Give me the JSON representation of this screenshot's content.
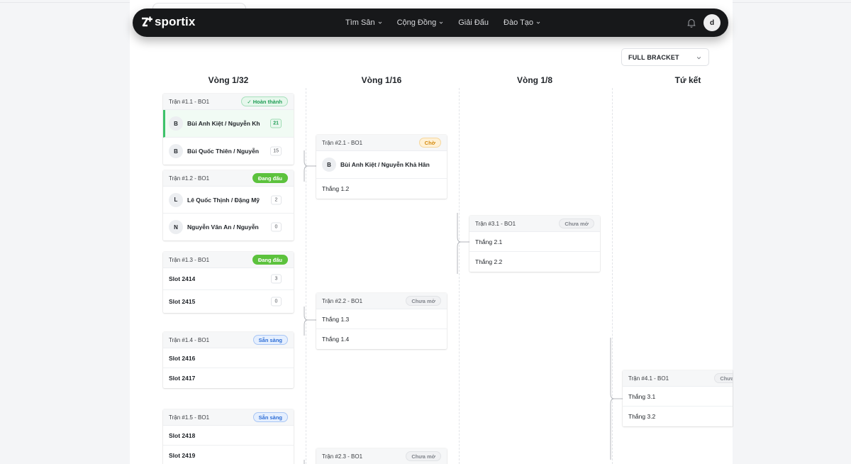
{
  "brand": {
    "name": "sportix"
  },
  "nav": {
    "items": [
      {
        "label": "Tìm Sân",
        "has_dropdown": true
      },
      {
        "label": "Cộng Đồng",
        "has_dropdown": true
      },
      {
        "label": "Giải Đấu",
        "has_dropdown": false
      },
      {
        "label": "Đào Tạo",
        "has_dropdown": true
      }
    ],
    "user_initial": "d"
  },
  "view_select": {
    "value": "FULL BRACKET"
  },
  "rounds": [
    "Vòng 1/32",
    "Vòng 1/16",
    "Vòng 1/8",
    "Tứ kết"
  ],
  "status_colors": {
    "done": "#1f9d55",
    "live": "#5cc23d",
    "ready": "#2f6fd6",
    "waiting": "#d48a0e",
    "closed": "#80848b"
  },
  "matches": {
    "m11": {
      "code": "Trận #1.1 - BO1",
      "status": "✓ Hoàn thành",
      "slots": [
        {
          "initial": "B",
          "name": "Bùi Anh Kiệt / Nguyễn Kh",
          "score": "21",
          "winner": true
        },
        {
          "initial": "B",
          "name": "Bùi Quốc Thiên / Nguyễn",
          "score": "15"
        }
      ]
    },
    "m12": {
      "code": "Trận #1.2 - BO1",
      "status": "Đang đấu",
      "slots": [
        {
          "initial": "L",
          "name": "Lê Quốc Thịnh / Đặng Mỹ",
          "score": "2"
        },
        {
          "initial": "N",
          "name": "Nguyễn Văn An / Nguyễn",
          "score": "0"
        }
      ]
    },
    "m13": {
      "code": "Trận #1.3 - BO1",
      "status": "Đang đấu",
      "slots": [
        {
          "name": "Slot 2414",
          "score": "3"
        },
        {
          "name": "Slot 2415",
          "score": "0"
        }
      ]
    },
    "m14": {
      "code": "Trận #1.4 - BO1",
      "status": "Sẵn sàng",
      "slots": [
        {
          "name": "Slot 2416"
        },
        {
          "name": "Slot 2417"
        }
      ]
    },
    "m15": {
      "code": "Trận #1.5 - BO1",
      "status": "Sẵn sàng",
      "slots": [
        {
          "name": "Slot 2418"
        },
        {
          "name": "Slot 2419"
        }
      ]
    },
    "m21": {
      "code": "Trận #2.1 - BO1",
      "status": "Chờ",
      "slots": [
        {
          "initial": "B",
          "name": "Bùi Anh Kiệt / Nguyễn Khả Hân"
        },
        {
          "name": "Thắng 1.2"
        }
      ]
    },
    "m22": {
      "code": "Trận #2.2 - BO1",
      "status": "Chưa mở",
      "slots": [
        {
          "name": "Thắng 1.3"
        },
        {
          "name": "Thắng 1.4"
        }
      ]
    },
    "m23": {
      "code": "Trận #2.3 - BO1",
      "status": "Chưa mở",
      "slots": []
    },
    "m31": {
      "code": "Trận #3.1 - BO1",
      "status": "Chưa mở",
      "slots": [
        {
          "name": "Thắng 2.1"
        },
        {
          "name": "Thắng 2.2"
        }
      ]
    },
    "m41": {
      "code": "Trận #4.1 - BO1",
      "status": "Chưa mở",
      "slots": [
        {
          "name": "Thắng 3.1"
        },
        {
          "name": "Thắng 3.2"
        }
      ]
    }
  }
}
